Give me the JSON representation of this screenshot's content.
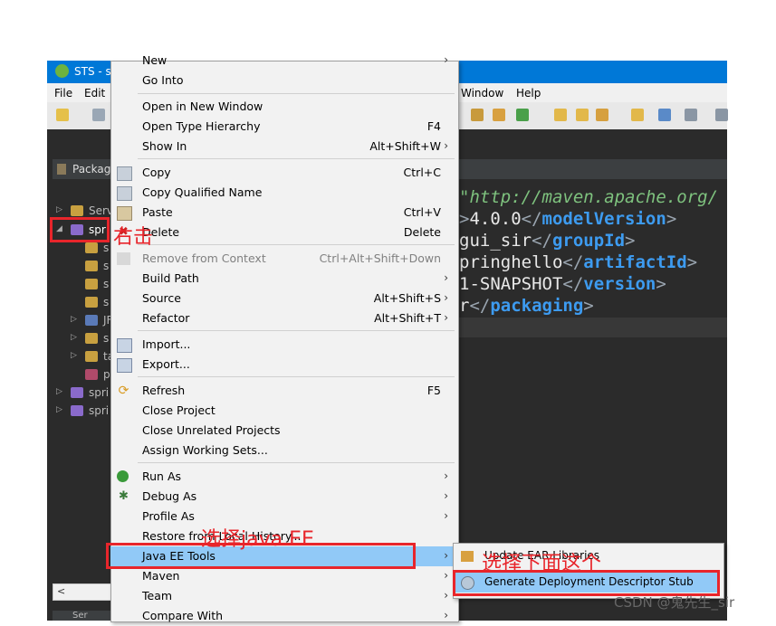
{
  "window": {
    "title": "STS - s",
    "menus": [
      "File",
      "Edit",
      "Window",
      "Help"
    ]
  },
  "package_explorer": {
    "tab_label": "Packag",
    "rows": [
      {
        "label": "Serv",
        "arrow": "▷"
      },
      {
        "label": "spr",
        "arrow": "◢"
      },
      {
        "label": "s",
        "arrow": ""
      },
      {
        "label": "s",
        "arrow": ""
      },
      {
        "label": "s",
        "arrow": ""
      },
      {
        "label": "s",
        "arrow": ""
      },
      {
        "label": "JF",
        "arrow": "▷"
      },
      {
        "label": "s",
        "arrow": "▷"
      },
      {
        "label": "ta",
        "arrow": "▷"
      },
      {
        "label": "p",
        "arrow": ""
      },
      {
        "label": "spri",
        "arrow": "▷"
      },
      {
        "label": "spri",
        "arrow": "▷"
      }
    ],
    "scroll_left": "<",
    "bottom_tab": "Ser"
  },
  "editor": {
    "lines": [
      {
        "a": "\"http://maven.apache.org/",
        "b": "",
        "c": ""
      },
      {
        "a": ">",
        "b": "4.0.0",
        "c": "</",
        "d": "modelVersion",
        "e": ">"
      },
      {
        "a": "",
        "b": "gui_sir",
        "c": "</",
        "d": "groupId",
        "e": ">"
      },
      {
        "a": "",
        "b": "pringhello",
        "c": "</",
        "d": "artifactId",
        "e": ">"
      },
      {
        "a": "",
        "b": "1-SNAPSHOT",
        "c": "</",
        "d": "version",
        "e": ">"
      },
      {
        "a": "",
        "b": "r",
        "c": "</",
        "d": "packaging",
        "e": ">"
      }
    ]
  },
  "context_menu": {
    "items": [
      {
        "label": "New",
        "shortcut": "",
        "submenu": true
      },
      {
        "label": "Go Into",
        "shortcut": ""
      },
      {
        "label": "Open in New Window",
        "shortcut": ""
      },
      {
        "label": "Open Type Hierarchy",
        "shortcut": "F4"
      },
      {
        "label": "Show In",
        "shortcut": "Alt+Shift+W",
        "submenu": true
      },
      {
        "label": "Copy",
        "shortcut": "Ctrl+C"
      },
      {
        "label": "Copy Qualified Name",
        "shortcut": ""
      },
      {
        "label": "Paste",
        "shortcut": "Ctrl+V"
      },
      {
        "label": "Delete",
        "shortcut": "Delete"
      },
      {
        "label": "Remove from Context",
        "shortcut": "Ctrl+Alt+Shift+Down"
      },
      {
        "label": "Build Path",
        "shortcut": "",
        "submenu": true
      },
      {
        "label": "Source",
        "shortcut": "Alt+Shift+S",
        "submenu": true
      },
      {
        "label": "Refactor",
        "shortcut": "Alt+Shift+T",
        "submenu": true
      },
      {
        "label": "Import...",
        "shortcut": ""
      },
      {
        "label": "Export...",
        "shortcut": ""
      },
      {
        "label": "Refresh",
        "shortcut": "F5"
      },
      {
        "label": "Close Project",
        "shortcut": ""
      },
      {
        "label": "Close Unrelated Projects",
        "shortcut": ""
      },
      {
        "label": "Assign Working Sets...",
        "shortcut": ""
      },
      {
        "label": "Run As",
        "shortcut": "",
        "submenu": true
      },
      {
        "label": "Debug As",
        "shortcut": "",
        "submenu": true
      },
      {
        "label": "Profile As",
        "shortcut": "",
        "submenu": true
      },
      {
        "label": "Restore from Local History...",
        "shortcut": ""
      },
      {
        "label": "Java EE Tools",
        "shortcut": "",
        "submenu": true
      },
      {
        "label": "Maven",
        "shortcut": "",
        "submenu": true
      },
      {
        "label": "Team",
        "shortcut": "",
        "submenu": true
      },
      {
        "label": "Compare With",
        "shortcut": "",
        "submenu": true
      }
    ],
    "submenu_arrow": "›"
  },
  "java_ee_submenu": {
    "items": [
      {
        "label": "Update EAR Libraries"
      },
      {
        "label": "Generate Deployment Descriptor Stub"
      }
    ]
  },
  "annotations": {
    "right_click": "右击",
    "choose_java_ee": "选择java EE",
    "choose_below": "选择下面这个"
  },
  "watermark": "CSDN @鬼先生_sir",
  "colors": {
    "title_bar": "#0078d7",
    "highlight": "#91c9f7",
    "annotation_red": "#e8252b",
    "dark_bg": "#2b2b2b"
  }
}
